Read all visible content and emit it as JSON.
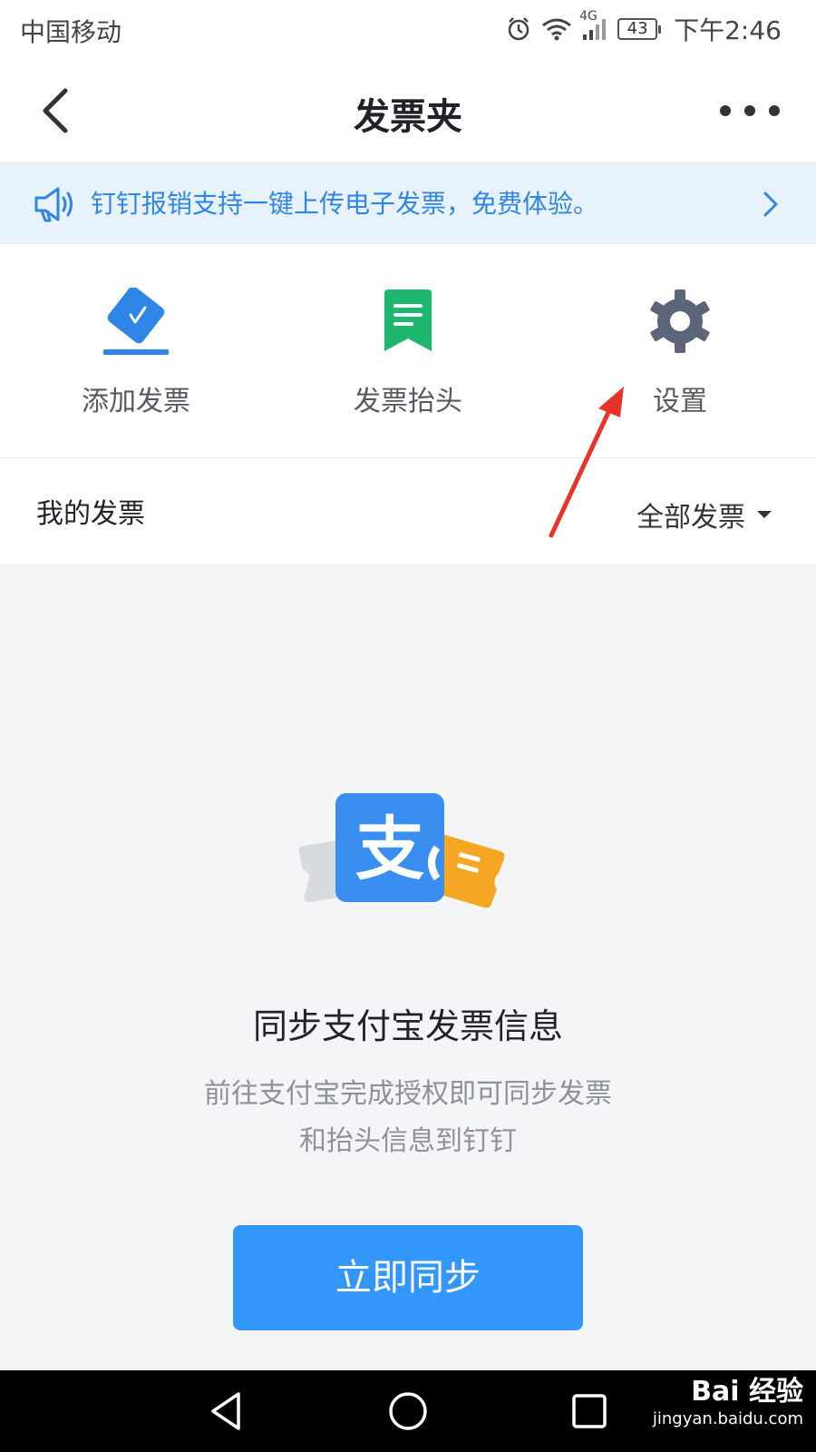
{
  "status_bar": {
    "carrier": "中国移动",
    "network": "4G",
    "battery": "43",
    "time": "下午2:46"
  },
  "header": {
    "title": "发票夹"
  },
  "banner": {
    "text": "钉钉报销支持一键上传电子发票，免费体验。"
  },
  "actions": [
    {
      "label": "添加发票",
      "icon": "add-invoice-icon",
      "color": "#2f86e6"
    },
    {
      "label": "发票抬头",
      "icon": "invoice-title-icon",
      "color": "#1fb76f"
    },
    {
      "label": "设置",
      "icon": "gear-icon",
      "color": "#5b6479"
    }
  ],
  "my_invoices": {
    "title": "我的发票",
    "filter_label": "全部发票"
  },
  "empty_state": {
    "illustration_glyph": "支",
    "title": "同步支付宝发票信息",
    "desc_line1": "前往支付宝完成授权即可同步发票",
    "desc_line2": "和抬头信息到钉钉",
    "button_label": "立即同步"
  },
  "watermark": {
    "main": "Bai 经验",
    "sub": "jingyan.baidu.com"
  },
  "colors": {
    "accent": "#3296fa",
    "banner_bg": "#e7f2fb",
    "banner_text": "#2f86e6",
    "annotation_arrow": "#e8332a"
  }
}
